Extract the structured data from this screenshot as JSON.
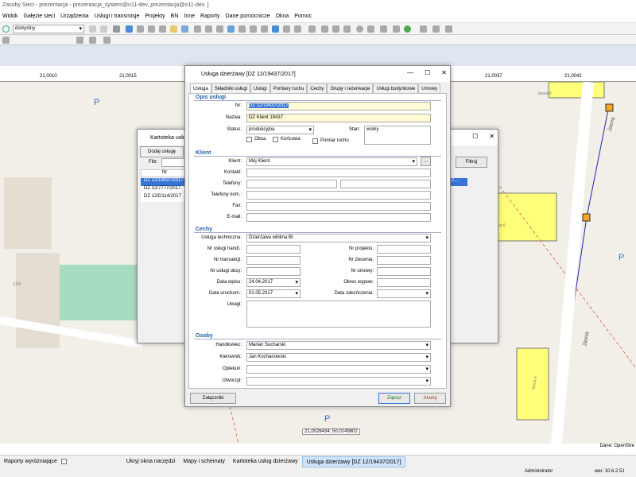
{
  "app": {
    "title": "Zasoby Sieci - prezentacja - prezentacja_system@o11-dev, prezentacja@o11-dev, ]"
  },
  "menu": [
    "Widok",
    "Gałęzie sieci",
    "Urządzenia",
    "Usługi i transmisje",
    "Projekty",
    "BN",
    "Inne",
    "Raporty",
    "Dane pomocnicze",
    "Okna",
    "Pomoc"
  ],
  "toolbar": {
    "scheme_select": "domyślny"
  },
  "ruler": {
    "labels": [
      "21,0010",
      "21,0015",
      "21,0037",
      "21,0042"
    ]
  },
  "map": {
    "labels": [
      "P",
      "P",
      "P",
      "154",
      "Jasna",
      "Jasna",
      "Jasna 8",
      "Jasna 6",
      "Jasna 4"
    ],
    "coordinates": "21,0026434; 50,0149802",
    "credit": "Dane: OpenStre"
  },
  "kartoteka": {
    "title": "Kartoteka usług",
    "add_button": "Dodaj usługę",
    "filter_label": "Filtr:",
    "filter_button": "Filtruj",
    "column_header": "Nr",
    "rows": [
      "DZ 12/19437/2017",
      "DZ 12/7777/2017",
      "DZ 12/D114/2017"
    ],
    "row_extra": "0.2..."
  },
  "dialog": {
    "title": "Usługa dzierżawy [DZ 12/19437/2017]",
    "tabs": [
      "Usługa",
      "Składniki usługi",
      "Usługi",
      "Pomiary ruchu",
      "Cechy",
      "Grupy i rezerwacje",
      "Usługi budynkowe",
      "Umowy"
    ],
    "sections": {
      "opis": "Opis usługi",
      "klient": "Klient",
      "cechy": "Cechy",
      "osoby": "Osoby"
    },
    "labels": {
      "nr": "Nr:",
      "nazwa": "Nazwa:",
      "status": "Status:",
      "stan": "Stan:",
      "obca": "Obca",
      "koncowa": "Końcowa",
      "pomiar": "Pomiar ruchu",
      "klient": "Klient:",
      "kontakt": "Kontakt:",
      "telefony": "Telefony:",
      "telefony_kom": "Telefony kom.:",
      "fax": "Fax:",
      "email": "E-mail:",
      "usluga_tech": "Usługa techniczna:",
      "nr_handl": "Nr usługi handl.:",
      "nr_transakcji": "Nr transakcji:",
      "nr_obcy": "Nr usługi obcy:",
      "data_wpisu": "Data wpisu:",
      "data_uruchom": "Data uruchom.:",
      "uwagi": "Uwagi:",
      "nr_projektu": "Nr projektu:",
      "nr_zlecenia": "Nr zlecenia:",
      "nr_umowy": "Nr umowy:",
      "okres": "Okres wypow:",
      "data_zak": "Data zakończenia:",
      "handlowiec": "Handlowiec:",
      "kierownik": "Kierownik:",
      "opiekun": "Opiekun:",
      "utworzyl": "Utworzył:"
    },
    "values": {
      "nr": "DZ 12/19437/2017",
      "nazwa": "DZ Klient 19437",
      "status": "produkcyjna",
      "stan": "wolny",
      "klient": "Mój Klient",
      "usluga_tech": "Dzierżawa włókna BI",
      "data_wpisu": "24.04.2017",
      "data_uruchom": "01.05.2017",
      "handlowiec": "Marian Sucharski",
      "kierownik": "Jan Kochanowski"
    },
    "buttons": {
      "attachments": "Załączniki",
      "save": "Zapisz",
      "cancel": "Anuluj",
      "more": "..."
    }
  },
  "statusbar": {
    "reports": "Raporty wyróżniające",
    "tasks": [
      "Ukryj okna narzędzi",
      "Mapy i schematy",
      "Kartoteka usług dzierżawy",
      "Usługa dzierżawy [DZ 12/19437/2017]"
    ],
    "user": "Administrator",
    "version": "wer. 10.6.2.51"
  }
}
